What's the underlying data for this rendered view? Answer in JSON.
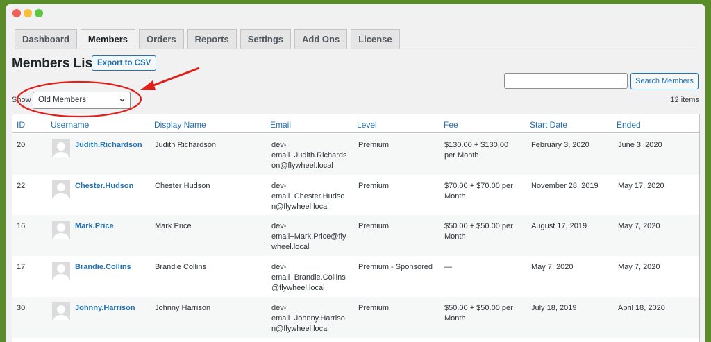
{
  "tabs": [
    {
      "label": "Dashboard",
      "active": false
    },
    {
      "label": "Members",
      "active": true
    },
    {
      "label": "Orders",
      "active": false
    },
    {
      "label": "Reports",
      "active": false
    },
    {
      "label": "Settings",
      "active": false
    },
    {
      "label": "Add Ons",
      "active": false
    },
    {
      "label": "License",
      "active": false
    }
  ],
  "page_title": "Members List",
  "export_label": "Export to CSV",
  "search": {
    "value": "",
    "button_label": "Search Members"
  },
  "filter": {
    "label": "Show",
    "selected": "Old Members"
  },
  "item_count": "12 items",
  "colors": {
    "link": "#2271b1",
    "annotation": "#e0201b",
    "frame": "#5b8c2a"
  },
  "table": {
    "headers": [
      "ID",
      "Username",
      "Display Name",
      "Email",
      "Level",
      "Fee",
      "Start Date",
      "Ended"
    ],
    "rows": [
      {
        "id": "20",
        "username": "Judith.Richardson",
        "display": "Judith Richardson",
        "email": [
          "dev-",
          "email+Judith.Richards",
          "on@flywheel.local"
        ],
        "level": "Premium",
        "fee": [
          "$130.00 + $130.00",
          "per Month"
        ],
        "start": "February 3, 2020",
        "ended": "June 3, 2020"
      },
      {
        "id": "22",
        "username": "Chester.Hudson",
        "display": "Chester Hudson",
        "email": [
          "dev-",
          "email+Chester.Hudso",
          "n@flywheel.local"
        ],
        "level": "Premium",
        "fee": [
          "$70.00 + $70.00 per",
          "Month"
        ],
        "start": "November 28, 2019",
        "ended": "May 17, 2020"
      },
      {
        "id": "16",
        "username": "Mark.Price",
        "display": "Mark Price",
        "email": [
          "dev-",
          "email+Mark.Price@fly",
          "wheel.local"
        ],
        "level": "Premium",
        "fee": [
          "$50.00 + $50.00 per",
          "Month"
        ],
        "start": "August 17, 2019",
        "ended": "May 7, 2020"
      },
      {
        "id": "17",
        "username": "Brandie.Collins",
        "display": "Brandie Collins",
        "email": [
          "dev-",
          "email+Brandie.Collins",
          "@flywheel.local"
        ],
        "level": "Premium - Sponsored",
        "fee": [
          "—",
          ""
        ],
        "start": "May 7, 2020",
        "ended": "May 7, 2020"
      },
      {
        "id": "30",
        "username": "Johnny.Harrison",
        "display": "Johnny Harrison",
        "email": [
          "dev-",
          "email+Johnny.Harriso",
          "n@flywheel.local"
        ],
        "level": "Premium",
        "fee": [
          "$50.00 + $50.00 per",
          "Month"
        ],
        "start": "July 18, 2019",
        "ended": "April 18, 2020"
      }
    ]
  }
}
